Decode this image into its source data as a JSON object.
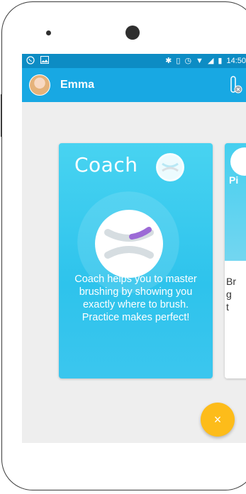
{
  "status_bar": {
    "time": "14:50",
    "icons": [
      "whatsapp-icon",
      "image-icon",
      "bluetooth-icon",
      "vibrate-icon",
      "alarm-icon",
      "wifi-icon",
      "signal-icon",
      "battery-icon"
    ]
  },
  "app_bar": {
    "user_name": "Emma",
    "avatar_icon": "user-avatar",
    "toothbrush_icon": "toothbrush-disconnected-icon"
  },
  "cards": {
    "coach": {
      "title": "Coach",
      "description": "Coach helps you to master brushing by showing you exactly where to brush. Practice makes perfect!",
      "color": "#33c4ee"
    },
    "next": {
      "title": "Pi",
      "description_fragment": "Br\ng\nt"
    }
  },
  "fab": {
    "label": "×",
    "color": "#fdbc1a"
  },
  "colors": {
    "status_bar": "#0d8cc4",
    "app_bar": "#18a8e3",
    "background": "#eeeeee"
  }
}
